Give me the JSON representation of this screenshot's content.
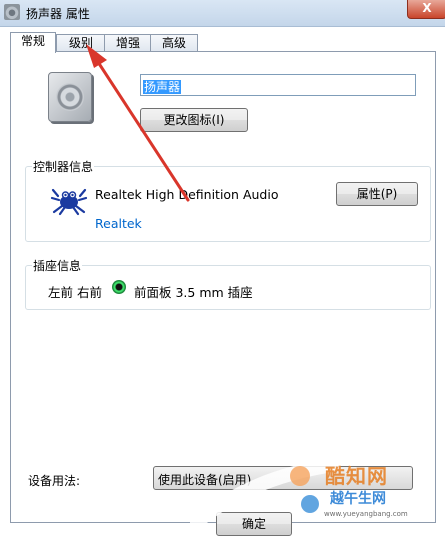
{
  "window": {
    "title": "扬声器 属性",
    "close_label": "X"
  },
  "tabs": [
    {
      "label": "常规",
      "active": true
    },
    {
      "label": "级别",
      "active": false
    },
    {
      "label": "增强",
      "active": false
    },
    {
      "label": "高级",
      "active": false
    }
  ],
  "general": {
    "device_icon": "speaker-icon",
    "name_value": "扬声器",
    "change_icon_button": "更改图标(I)"
  },
  "controller": {
    "group_label": "控制器信息",
    "logo": "realtek-crab-logo",
    "device_name": "Realtek High Definition Audio",
    "vendor_link": "Realtek",
    "properties_button": "属性(P)"
  },
  "jack": {
    "group_label": "插座信息",
    "channels": "左前 右前",
    "indicator_color": "#3ee06b",
    "description": "前面板 3.5 mm 插座"
  },
  "usage": {
    "label": "设备用法:",
    "selected": "使用此设备(启用)"
  },
  "footer": {
    "ok_button": "确定"
  },
  "annotation": {
    "color": "#d9362b"
  },
  "watermark": {
    "brand": "酷知网",
    "brand2": "越午生网",
    "url": "www.yueyangbang.com"
  }
}
